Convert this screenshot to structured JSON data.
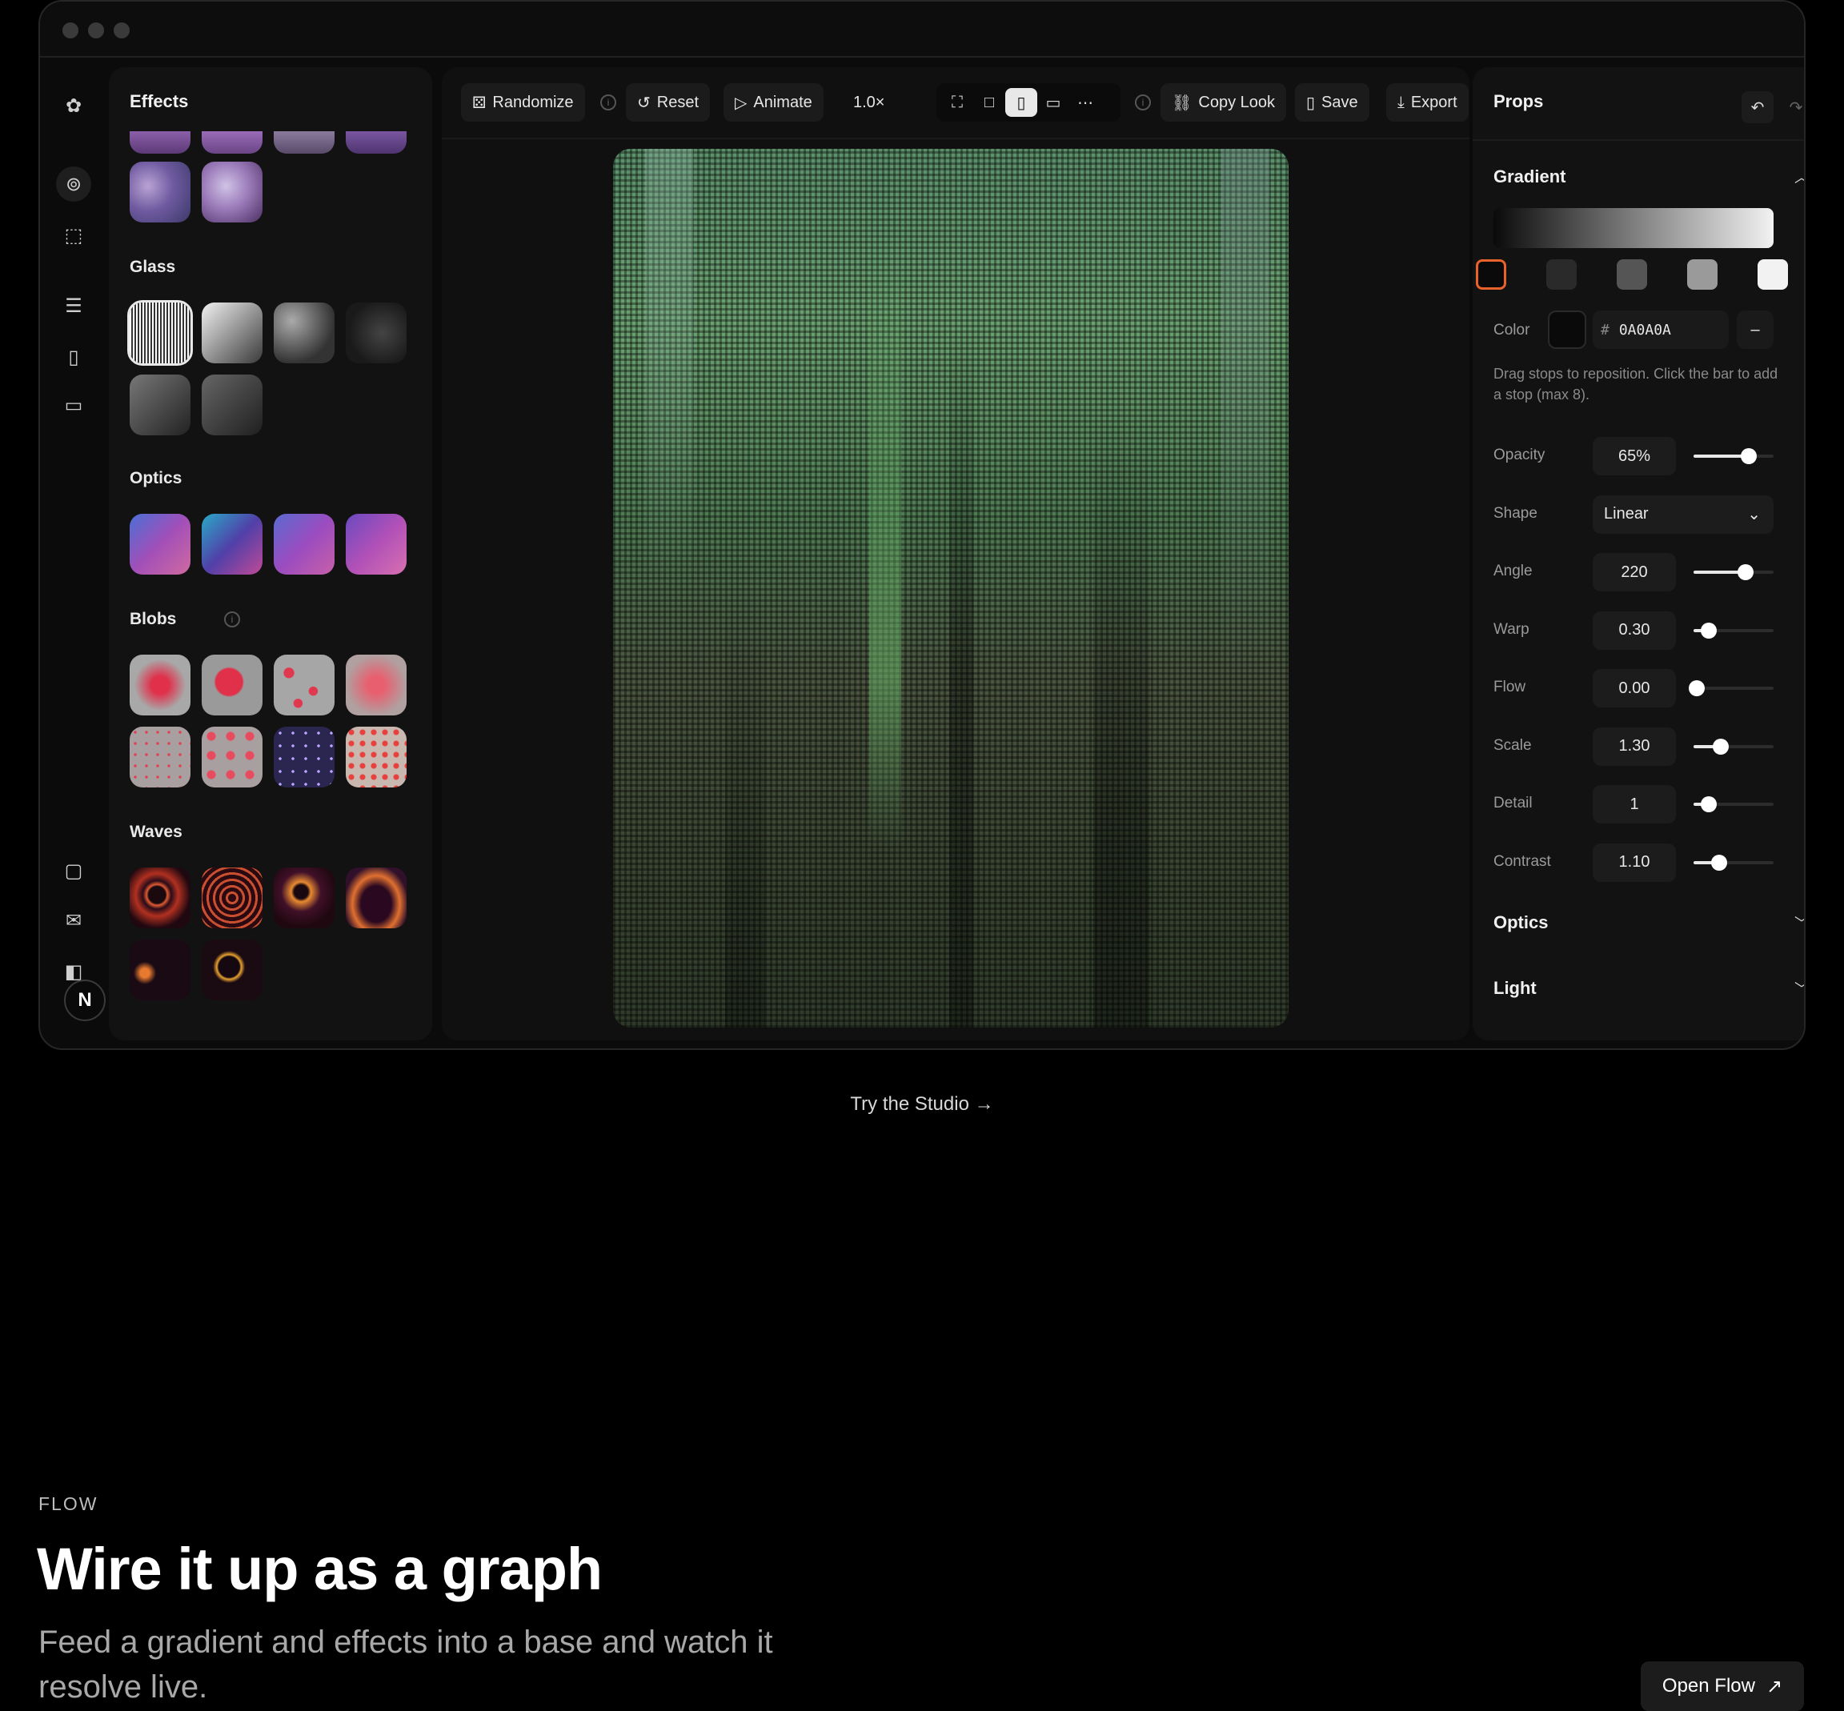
{
  "effects_panel": {
    "title": "Effects",
    "sections": {
      "glass": "Glass",
      "optics": "Optics",
      "blobs": "Blobs",
      "waves": "Waves"
    }
  },
  "toolbar": {
    "randomize": "Randomize",
    "reset": "Reset",
    "animate": "Animate",
    "speed": "1.0×",
    "copy_look": "Copy Look",
    "save": "Save",
    "export": "Export"
  },
  "props": {
    "title": "Props",
    "gradient": {
      "title": "Gradient",
      "stops": [
        "#0A0A0A",
        "#2A2A2A",
        "#555555",
        "#9A9A9A",
        "#F2F2F2"
      ],
      "color_label": "Color",
      "hash": "#",
      "color_value": "0A0A0A",
      "remove": "–",
      "hint": "Drag stops to reposition. Click the bar to add a stop (max 8)."
    },
    "rows": [
      {
        "label": "Opacity",
        "value": "65%",
        "level": 0.65
      },
      {
        "label": "Shape",
        "value": "Linear"
      },
      {
        "label": "Angle",
        "value": "220",
        "level": 0.61
      },
      {
        "label": "Warp",
        "value": "0.30",
        "level": 0.15
      },
      {
        "label": "Flow",
        "value": "0.00",
        "level": 0.0
      },
      {
        "label": "Scale",
        "value": "1.30",
        "level": 0.3
      },
      {
        "label": "Detail",
        "value": "1",
        "level": 0.15
      },
      {
        "label": "Contrast",
        "value": "1.10",
        "level": 0.28
      }
    ],
    "optics": "Optics",
    "light": "Light"
  },
  "cta": "Try the Studio",
  "section": {
    "kicker": "FLOW",
    "headline": "Wire it up as a graph",
    "description": "Feed a gradient and effects into a base and watch it resolve live.",
    "open_button": "Open Flow"
  },
  "colors": {
    "accent_stop": "#E8622C",
    "canvas_green": "#5A8F6A"
  }
}
